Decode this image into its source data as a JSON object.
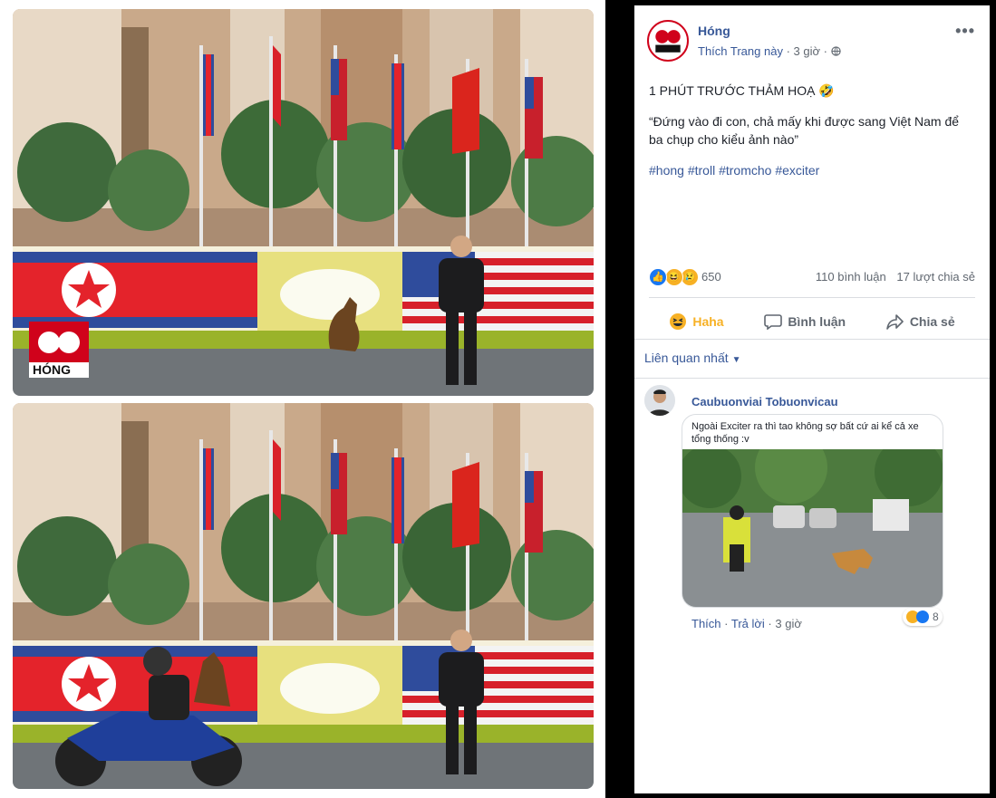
{
  "page": {
    "name": "Hóng",
    "logo_text": "HÓNG",
    "like_link": "Thích Trang này",
    "time": "3 giờ",
    "privacy_icon": "globe-icon"
  },
  "post": {
    "headline": "1 PHÚT TRƯỚC THẢM HOẠ 🤣",
    "quote": "“Đứng vào đi con, chả mấy khi được sang Việt Nam để ba chụp cho kiểu ảnh nào”",
    "hashtags": [
      "#hong",
      "#troll",
      "#tromcho",
      "#exciter"
    ]
  },
  "stats": {
    "reaction_count": "650",
    "comments": "110 bình luận",
    "shares": "17 lượt chia sẻ",
    "reaction_icons": [
      "like-icon",
      "haha-icon",
      "sad-icon"
    ]
  },
  "actions": {
    "react_label": "Haha",
    "comment_label": "Bình luận",
    "share_label": "Chia sẻ"
  },
  "sort": {
    "label": "Liên quan nhất"
  },
  "comment": {
    "author": "Caubuonviai Tobuonvicau",
    "text": "Ngoài Exciter ra thì tao không sợ bất cứ ai kể cả xe tổng thống :v",
    "like_label": "Thích",
    "reply_label": "Trả lời",
    "time": "3 giờ",
    "reaction_count": "8"
  },
  "colors": {
    "link": "#385898",
    "haha": "#f7b125",
    "like": "#1877f2",
    "dprk_red": "#e4232b",
    "usa_blue": "#2f4c9c"
  }
}
